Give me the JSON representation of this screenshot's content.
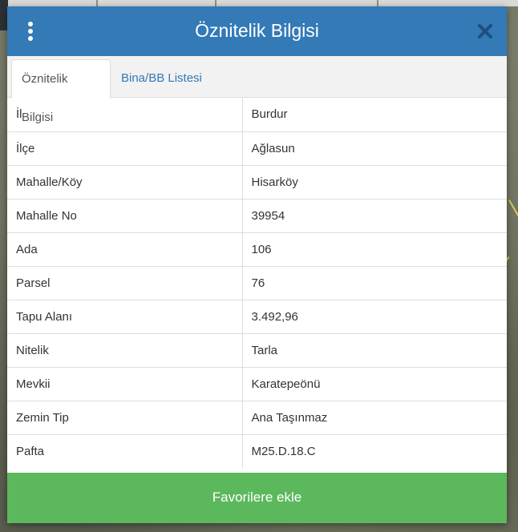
{
  "dialog": {
    "title": "Öznitelik Bilgisi",
    "menu_icon": "vertical-ellipsis-icon",
    "close_icon": "close-icon"
  },
  "tabs": [
    {
      "label": "Öznitelik Bilgisi",
      "active": true
    },
    {
      "label": "Bina/BB Listesi",
      "active": false
    }
  ],
  "attributes": [
    {
      "key": "İl",
      "value": "Burdur"
    },
    {
      "key": "İlçe",
      "value": "Ağlasun"
    },
    {
      "key": "Mahalle/Köy",
      "value": "Hisarköy"
    },
    {
      "key": "Mahalle No",
      "value": "39954"
    },
    {
      "key": "Ada",
      "value": "106"
    },
    {
      "key": "Parsel",
      "value": "76"
    },
    {
      "key": "Tapu Alanı",
      "value": "3.492,96"
    },
    {
      "key": "Nitelik",
      "value": "Tarla"
    },
    {
      "key": "Mevkii",
      "value": "Karatepeönü"
    },
    {
      "key": "Zemin Tip",
      "value": "Ana Taşınmaz"
    },
    {
      "key": "Pafta",
      "value": "M25.D.18.C"
    }
  ],
  "footer": {
    "favorite_label": "Favorilere ekle"
  },
  "colors": {
    "header": "#337ab7",
    "favorite_button": "#5cb85c",
    "tab_link": "#337ab7"
  }
}
